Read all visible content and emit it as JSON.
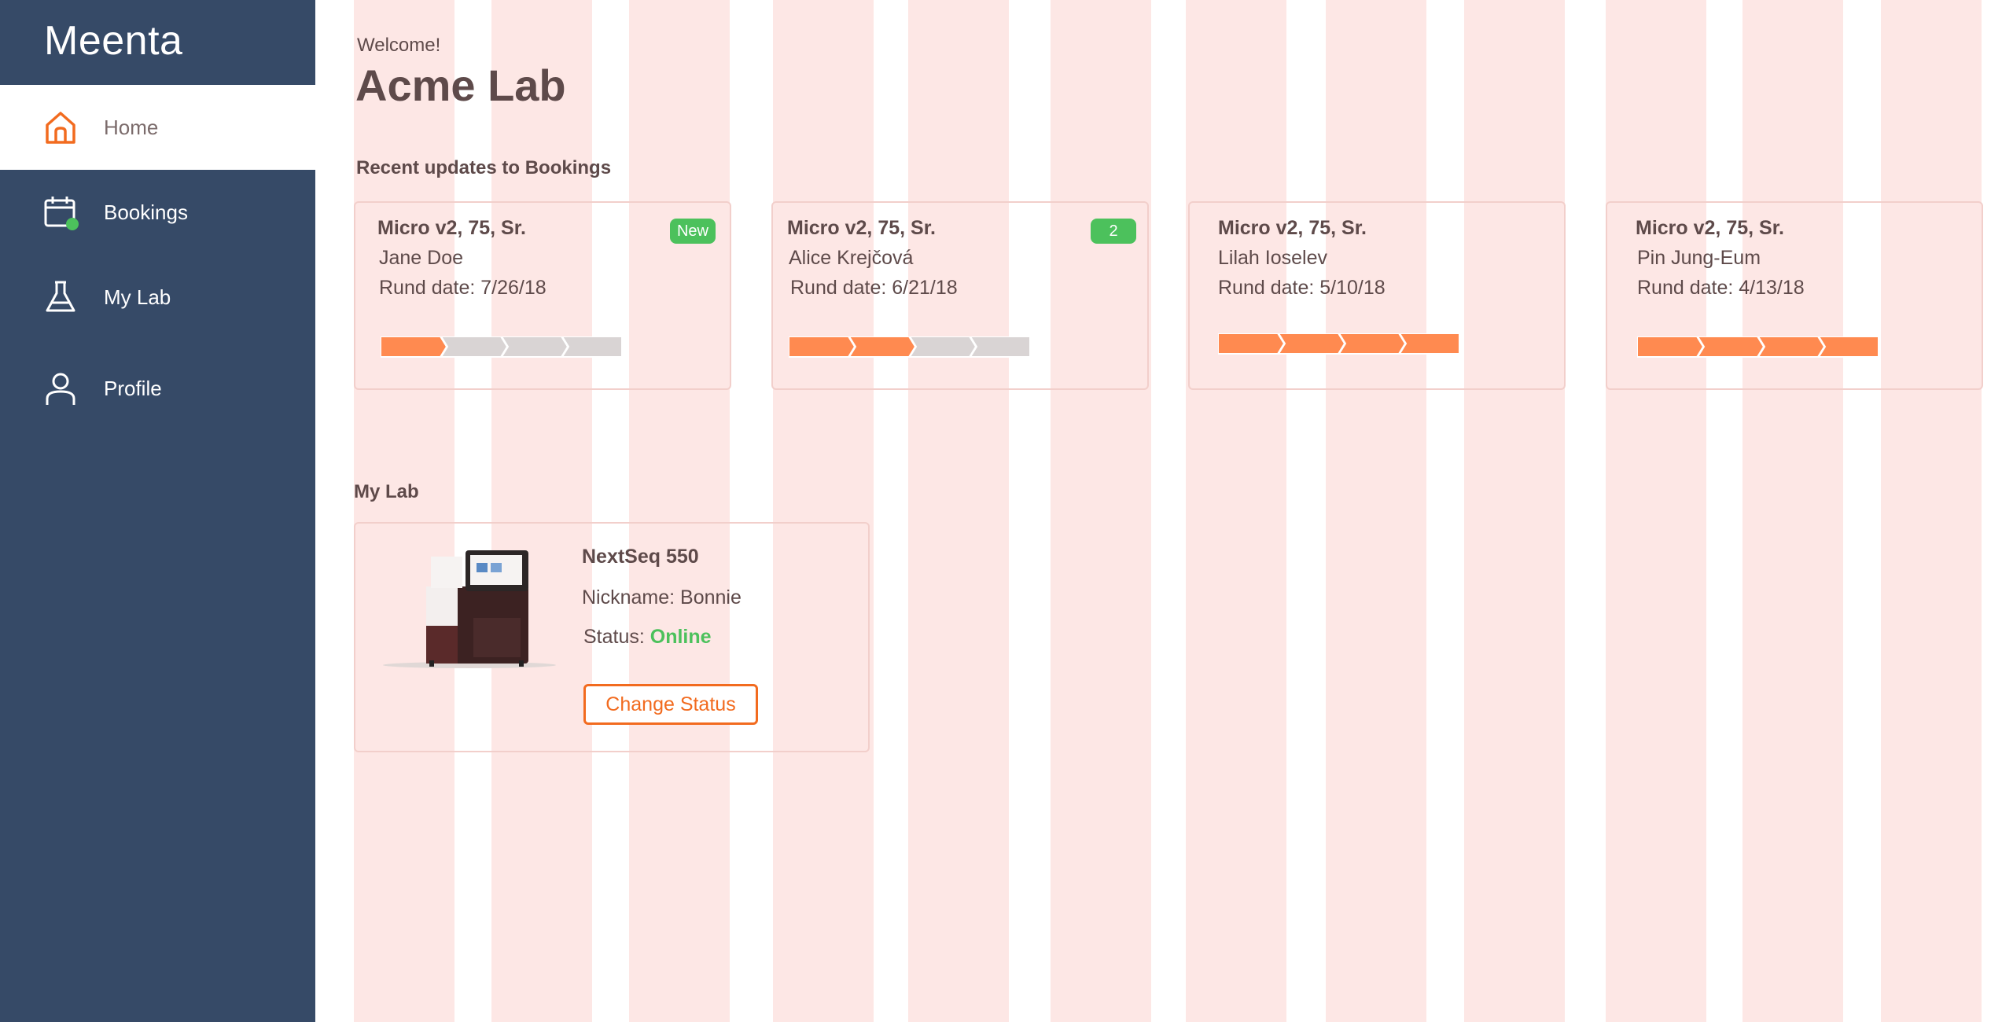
{
  "app": {
    "brand": "Meenta"
  },
  "sidebar": {
    "items": [
      {
        "label": "Home",
        "icon": "home-icon",
        "active": true
      },
      {
        "label": "Bookings",
        "icon": "calendar-icon",
        "active": false
      },
      {
        "label": "My Lab",
        "icon": "flask-icon",
        "active": false
      },
      {
        "label": "Profile",
        "icon": "user-icon",
        "active": false
      }
    ]
  },
  "header": {
    "welcome": "Welcome!",
    "lab_name": "Acme Lab"
  },
  "bookings": {
    "title": "Recent updates to Bookings",
    "cards": [
      {
        "title": "Micro v2, 75, Sr.",
        "name": "Jane Doe",
        "date": "Rund date: 7/26/18",
        "badge": "New",
        "progress_steps_done": 1,
        "progress_steps_total": 4
      },
      {
        "title": "Micro v2, 75, Sr.",
        "name": "Alice Krejčová",
        "date": "Rund date: 6/21/18",
        "badge": "2",
        "progress_steps_done": 2,
        "progress_steps_total": 4
      },
      {
        "title": "Micro v2, 75, Sr.",
        "name": "Lilah Ioselev",
        "date": "Rund date: 5/10/18",
        "badge": "",
        "progress_steps_done": 4,
        "progress_steps_total": 4
      },
      {
        "title": "Micro v2, 75, Sr.",
        "name": "Pin Jung-Eum",
        "date": "Rund date: 4/13/18",
        "badge": "",
        "progress_steps_done": 4,
        "progress_steps_total": 4
      }
    ]
  },
  "mylab": {
    "title": "My Lab",
    "device": {
      "name": "NextSeq 550",
      "nickname": "Nickname: Bonnie",
      "status_label": "Status: ",
      "status_value": "Online",
      "button": "Change Status"
    }
  },
  "colors": {
    "sidebar": "#364a67",
    "accent": "#f26b1f",
    "progress_done": "#ff8a50",
    "progress_todo": "#d9d4d4",
    "online": "#4cc15c",
    "grid": "#fde7e5"
  }
}
